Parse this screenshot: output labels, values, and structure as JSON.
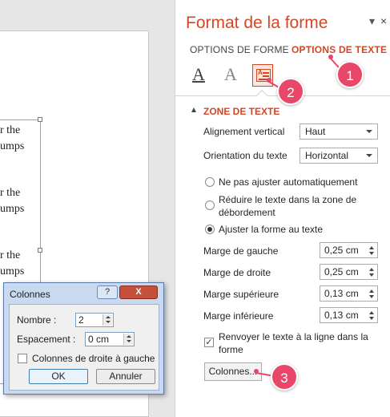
{
  "document": {
    "lines": [
      "r the",
      "umps",
      "r the",
      "umps",
      "r the",
      "umps"
    ]
  },
  "pane": {
    "title": "Format de la forme",
    "pin_glyph": "▾",
    "close_glyph": "×",
    "tabs": [
      "OPTIONS DE FORME",
      "OPTIONS DE TEXTE"
    ],
    "icons": [
      "text-fill-outline-icon",
      "text-effects-icon",
      "text-box-icon"
    ],
    "section_title": "ZONE DE TEXTE",
    "vertical_alignment": {
      "label": "Alignement vertical",
      "value": "Haut"
    },
    "text_direction": {
      "label": "Orientation du texte",
      "value": "Horizontal"
    },
    "autofit": {
      "options": [
        "Ne pas ajuster automatiquement",
        "Réduire le texte dans la zone de",
        "débordement",
        "Ajuster la forme au texte"
      ],
      "selected": 2
    },
    "margins": [
      {
        "label": "Marge de gauche",
        "value": "0,25 cm"
      },
      {
        "label": "Marge de droite",
        "value": "0,25 cm"
      },
      {
        "label": "Marge supérieure",
        "value": "0,13 cm"
      },
      {
        "label": "Marge inférieure",
        "value": "0,13 cm"
      }
    ],
    "wrap": {
      "line1": "Renvoyer le texte à la ligne dans la",
      "line2": "forme",
      "checked": true,
      "mark": "✓"
    },
    "columns_button": "Colonnes..."
  },
  "callouts": [
    "1",
    "2",
    "3"
  ],
  "dialog": {
    "title": "Colonnes",
    "help": "?",
    "close": "X",
    "number_label": "Nombre :",
    "number_value": "2",
    "spacing_label": "Espacement :",
    "spacing_value": "0 cm",
    "rtl_label": "Colonnes de droite à gauche",
    "ok": "OK",
    "cancel": "Annuler"
  },
  "colors": {
    "accent": "#d24726",
    "callout": "#e8476a"
  }
}
